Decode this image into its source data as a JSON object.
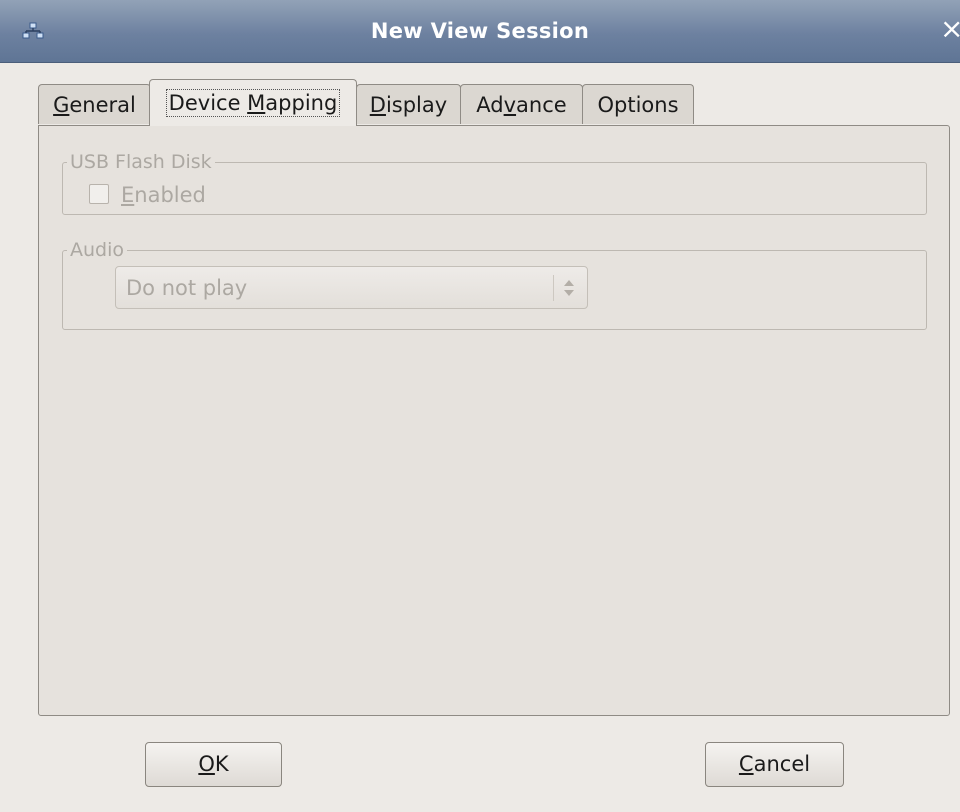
{
  "window": {
    "title": "New View Session",
    "icon": "network-icon",
    "close_glyph": "×"
  },
  "tabs": [
    {
      "pre": "",
      "ul": "G",
      "post": "eneral",
      "active": false
    },
    {
      "pre": "Device ",
      "ul": "M",
      "post": "apping",
      "active": true
    },
    {
      "pre": "",
      "ul": "D",
      "post": "isplay",
      "active": false
    },
    {
      "pre": "Ad",
      "ul": "v",
      "post": "ance",
      "active": false
    },
    {
      "pre": "Options",
      "ul": "",
      "post": "",
      "active": false
    }
  ],
  "usb": {
    "legend": "USB Flash Disk",
    "checkbox": {
      "ul": "E",
      "post": "nabled",
      "checked": false,
      "disabled": true
    }
  },
  "audio": {
    "legend": "Audio",
    "selected": "Do not play",
    "disabled": true
  },
  "buttons": {
    "ok": {
      "ul": "O",
      "post": "K"
    },
    "cancel": {
      "ul": "C",
      "post": "ancel"
    }
  },
  "colors": {
    "titlebar": "#6d81a0",
    "window_bg": "#edeae6",
    "disabled_text": "#aca8a2"
  }
}
